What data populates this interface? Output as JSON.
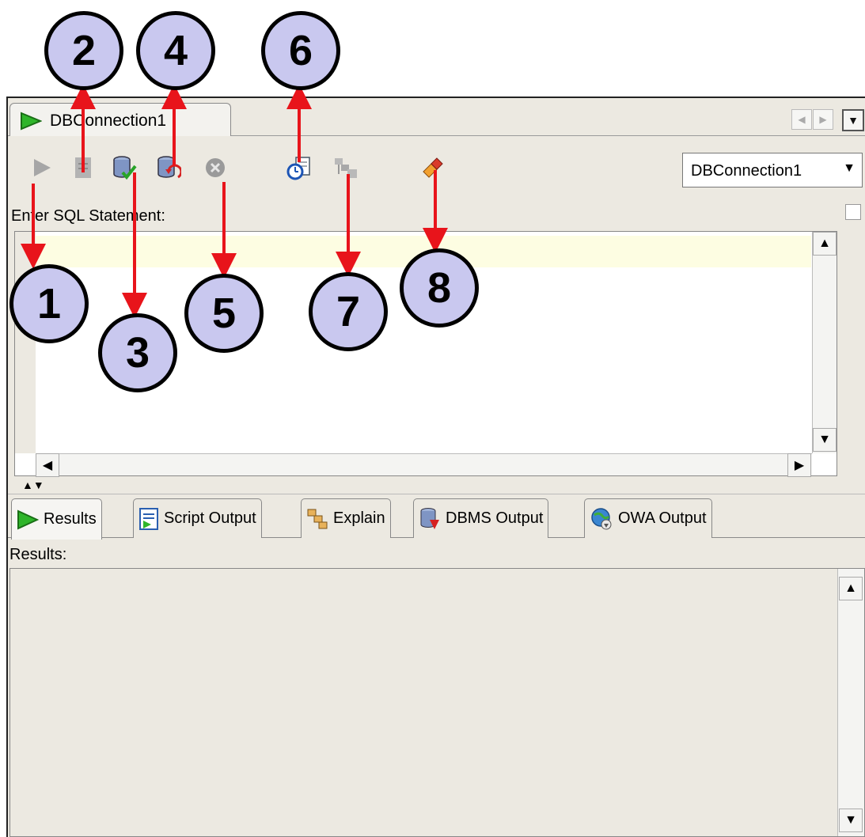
{
  "editor_tab": {
    "label": "DBConnection1",
    "icon": "play-icon"
  },
  "tab_navigation": {
    "prev_icon": "chevron-left-icon",
    "next_icon": "chevron-right-icon",
    "menu_icon": "chevron-down-icon"
  },
  "toolbar": {
    "items": [
      {
        "icon": "run-statement-icon",
        "enabled": false
      },
      {
        "icon": "run-script-icon",
        "enabled": false
      },
      {
        "icon": "commit-icon",
        "enabled": true
      },
      {
        "icon": "rollback-icon",
        "enabled": true
      },
      {
        "icon": "cancel-icon",
        "enabled": false
      },
      {
        "icon": "sql-history-icon",
        "enabled": true
      },
      {
        "icon": "execute-explain-plan-icon",
        "enabled": false
      },
      {
        "icon": "clear-icon",
        "enabled": true
      }
    ],
    "connection_select": {
      "value": "DBConnection1"
    }
  },
  "editor": {
    "label": "Enter SQL Statement:",
    "content": ""
  },
  "results_tabs": [
    {
      "label": "Results",
      "icon": "play-icon",
      "active": true
    },
    {
      "label": "Script Output",
      "icon": "script-output-icon",
      "active": false
    },
    {
      "label": "Explain",
      "icon": "explain-icon",
      "active": false
    },
    {
      "label": "DBMS Output",
      "icon": "dbms-output-icon",
      "active": false
    },
    {
      "label": "OWA Output",
      "icon": "owa-output-icon",
      "active": false
    }
  ],
  "results": {
    "label": "Results:"
  },
  "callouts": [
    "1",
    "2",
    "3",
    "4",
    "5",
    "6",
    "7",
    "8"
  ],
  "colors": {
    "callout_fill": "#c9c8ef",
    "arrow": "#e8141b",
    "panel_bg": "#ece9e1",
    "current_line": "#fdfde2"
  }
}
